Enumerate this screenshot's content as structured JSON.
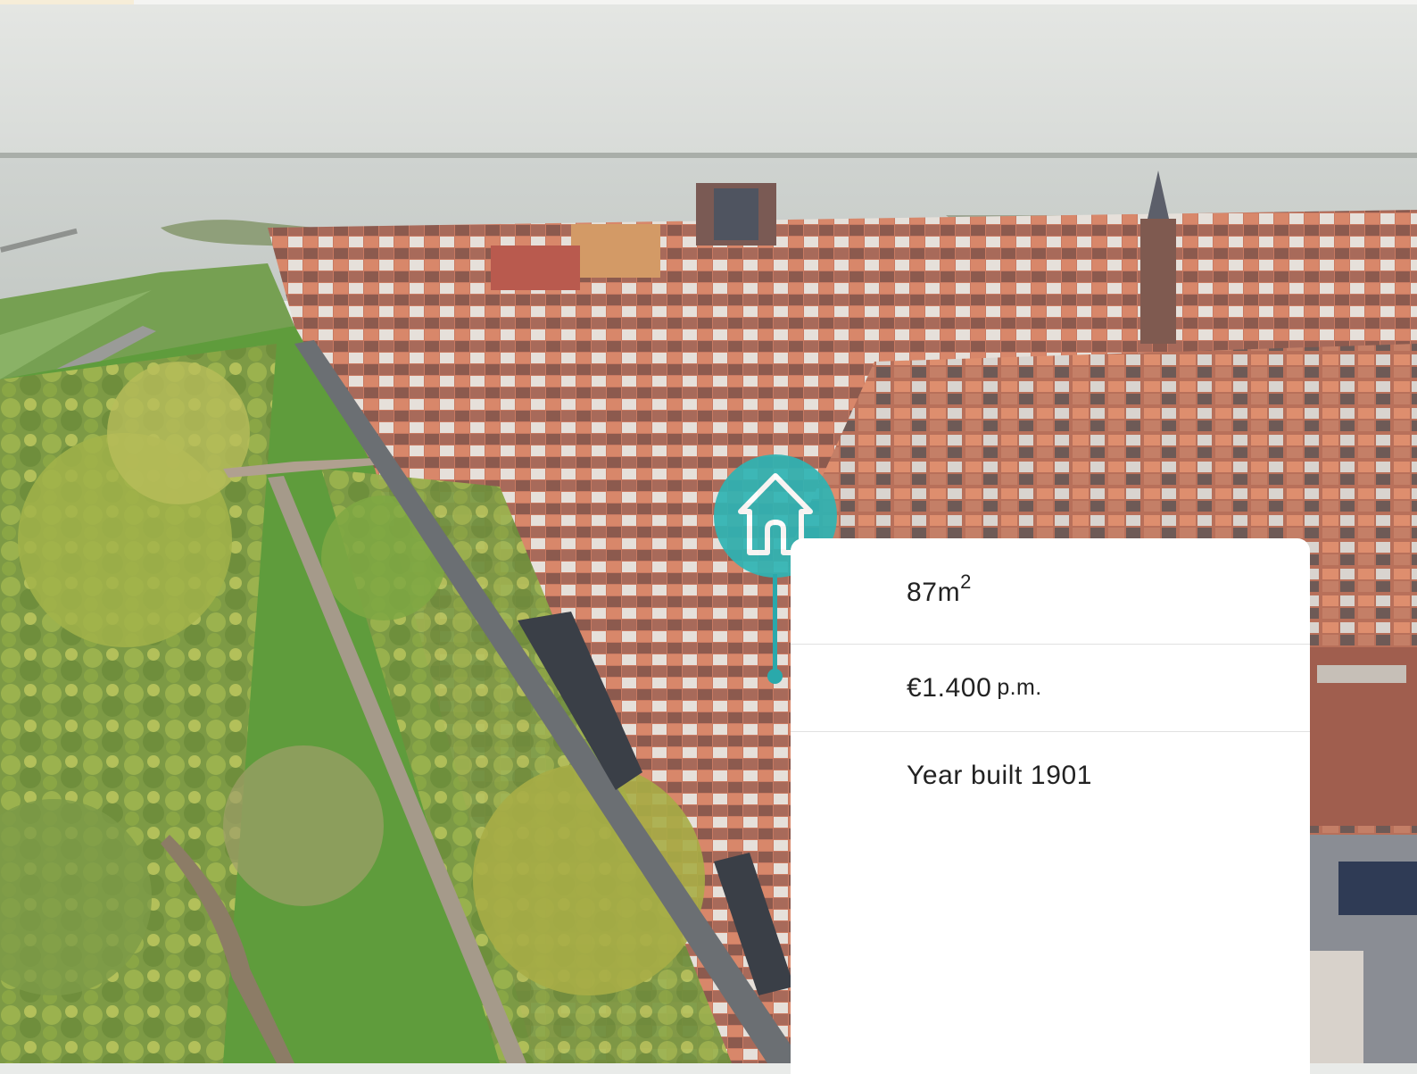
{
  "listing": {
    "area_value": "87m",
    "area_exponent": "2",
    "price": "€1.400",
    "price_period": "p.m.",
    "year_built": "Year built 1901"
  },
  "pin": {
    "icon": "house-icon",
    "color": "#2fb4b4"
  },
  "photo": {
    "subject": "aerial-town-view"
  }
}
